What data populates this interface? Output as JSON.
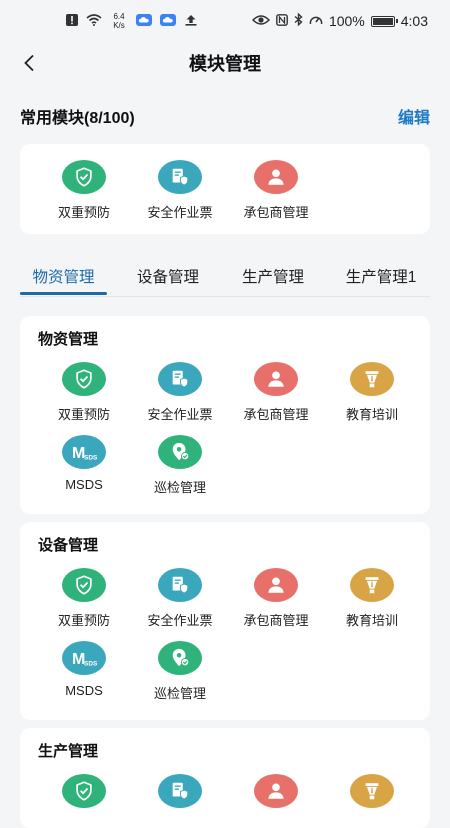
{
  "status_bar": {
    "net_speed_value": "6.4",
    "net_speed_unit": "K/s",
    "battery": "100%",
    "time": "4:03"
  },
  "header": {
    "title": "模块管理"
  },
  "common": {
    "title": "常用模块(8/100)",
    "edit_label": "编辑"
  },
  "modules": {
    "shuangchong": "双重预防",
    "anquan": "安全作业票",
    "chengbao": "承包商管理",
    "jiaoyu": "教育培训",
    "msds": "MSDS",
    "xunjian": "巡检管理"
  },
  "tabs": [
    "物资管理",
    "设备管理",
    "生产管理",
    "生产管理1"
  ],
  "sections": [
    "物资管理",
    "设备管理",
    "生产管理"
  ],
  "colors": {
    "green": "#2fb37a",
    "teal": "#3aa7bd",
    "coral": "#e8706a",
    "gold": "#d9a446",
    "accent": "#1e7ac4",
    "tab_active": "#1e6aa8"
  },
  "icons": {
    "shuangchong": "shield-check-icon",
    "anquan": "document-shield-icon",
    "chengbao": "person-icon",
    "jiaoyu": "pen-nib-icon",
    "msds": "msds-icon",
    "xunjian": "map-pin-check-icon"
  }
}
